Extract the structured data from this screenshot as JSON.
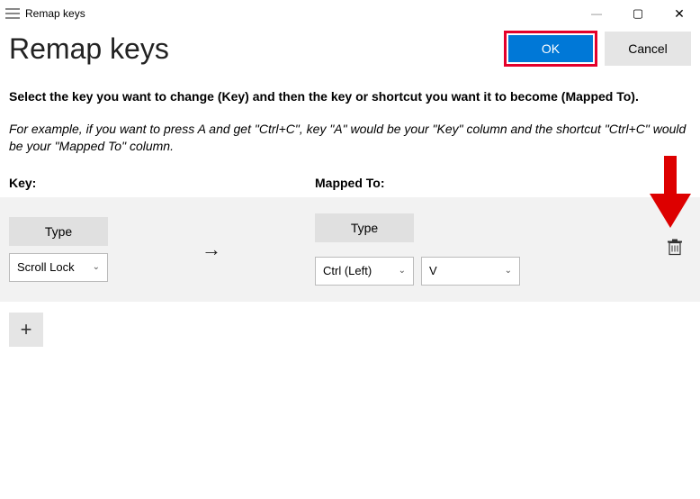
{
  "window": {
    "title": "Remap keys"
  },
  "header": {
    "page_title": "Remap keys",
    "ok_label": "OK",
    "cancel_label": "Cancel"
  },
  "instructions": {
    "main": "Select the key you want to change (Key) and then the key or shortcut you want it to become (Mapped To).",
    "example": "For example, if you want to press A and get \"Ctrl+C\", key \"A\" would be your \"Key\" column and the shortcut \"Ctrl+C\" would be your \"Mapped To\" column."
  },
  "columns": {
    "key_label": "Key:",
    "mapped_label": "Mapped To:"
  },
  "row": {
    "type_button": "Type",
    "key_value": "Scroll Lock",
    "mapped_type_button": "Type",
    "mapped_value_1": "Ctrl (Left)",
    "mapped_value_2": "V"
  },
  "icons": {
    "arrow": "→",
    "chevron": "⌄",
    "trash": "🗑",
    "plus": "+",
    "minimize": "—",
    "maximize": "▢",
    "close": "✕"
  }
}
